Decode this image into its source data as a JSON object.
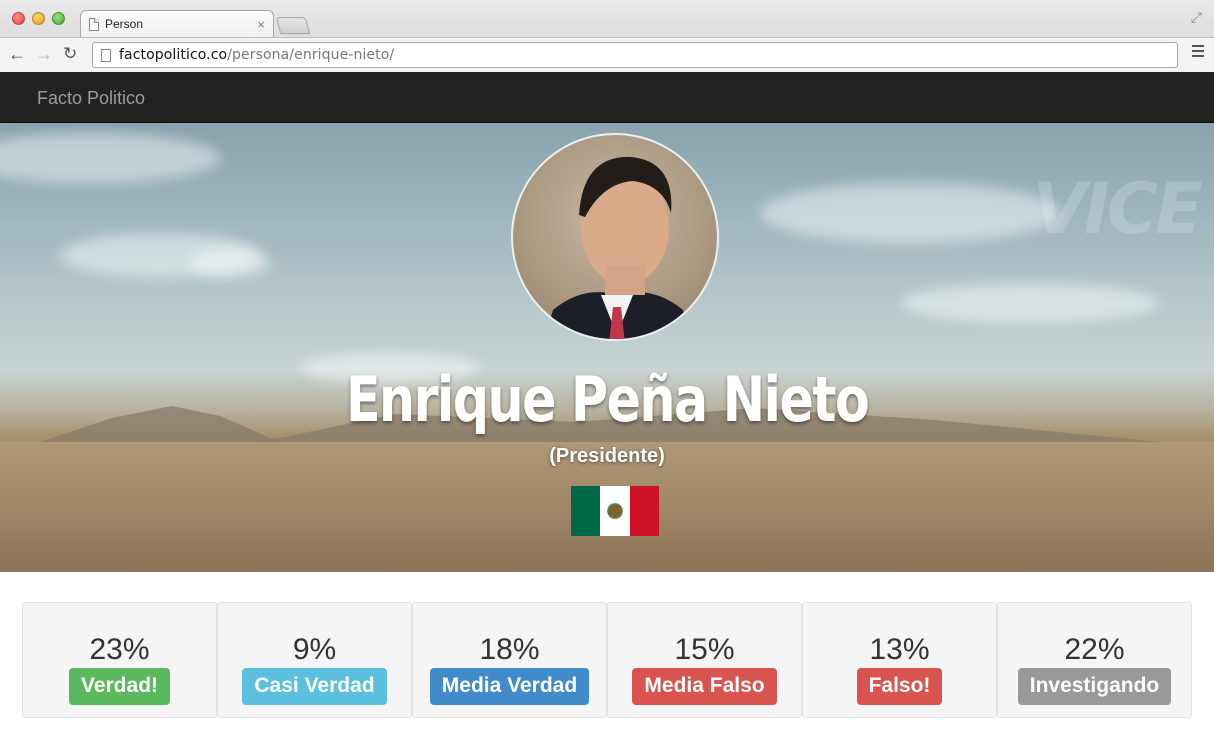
{
  "browser": {
    "tab_title": "Person",
    "url_host": "factopolitico.co",
    "url_path": "/persona/enrique-nieto/"
  },
  "site": {
    "brand": "Facto Politico"
  },
  "profile": {
    "name": "Enrique Peña Nieto",
    "role": "(Presidente)",
    "country_flag": "mexico-flag",
    "watermark": "VICE"
  },
  "stats": [
    {
      "percent": "23%",
      "label": "Verdad!",
      "color": "#5cb85c"
    },
    {
      "percent": "9%",
      "label": "Casi Verdad",
      "color": "#5bc0de"
    },
    {
      "percent": "18%",
      "label": "Media Verdad",
      "color": "#428bca"
    },
    {
      "percent": "15%",
      "label": "Media Falso",
      "color": "#d9534f"
    },
    {
      "percent": "13%",
      "label": "Falso!",
      "color": "#d9534f"
    },
    {
      "percent": "22%",
      "label": "Investigando",
      "color": "#999999"
    }
  ]
}
